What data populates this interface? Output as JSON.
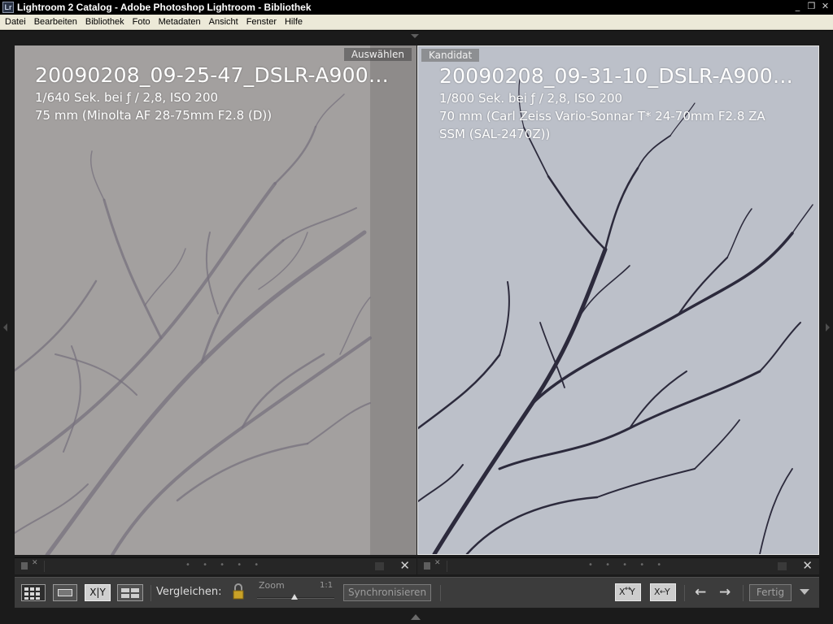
{
  "window": {
    "app_icon": "Lr",
    "title": "Lightroom 2 Catalog - Adobe Photoshop Lightroom - Bibliothek",
    "controls": [
      "minimize-icon",
      "restore-icon",
      "close-icon"
    ]
  },
  "menu": [
    "Datei",
    "Bearbeiten",
    "Bibliothek",
    "Foto",
    "Metadaten",
    "Ansicht",
    "Fenster",
    "Hilfe"
  ],
  "select_panel": {
    "badge": "Auswählen",
    "filename": "20090208_09-25-47_DSLR-A900…",
    "exposure": "1/640 Sek. bei ƒ / 2,8, ISO 200",
    "lens_line1": "75 mm (Minolta AF 28-75mm F2.8 (D))",
    "lens_line2": ""
  },
  "candidate_panel": {
    "badge": "Kandidat",
    "filename": "20090208_09-31-10_DSLR-A900…",
    "exposure": "1/800 Sek. bei ƒ / 2,8, ISO 200",
    "lens_line1": "70 mm (Carl Zeiss Vario-Sonnar T* 24-70mm F2.8 ZA",
    "lens_line2": "SSM (SAL-2470Z))"
  },
  "panel_footer": {
    "dots": "• • • • •",
    "close": "✕"
  },
  "toolbar": {
    "grid_icon": "grid-view-icon",
    "loupe_icon": "loupe-view-icon",
    "compare_label": "X|Y",
    "survey_icon": "survey-view-icon",
    "compare_text": "Vergleichen:",
    "lock_icon": "lock-icon",
    "zoom_label": "Zoom",
    "zoom_value": "1:1",
    "zoom_level": 0.48,
    "sync_label": "Synchronisieren",
    "swap_icon": "swap-icon",
    "make_select_icon": "make-select-icon",
    "prev_icon": "←",
    "next_icon": "→",
    "done_label": "Fertig"
  },
  "colors": {
    "left_photo_bg": "#a3a09f",
    "right_photo_bg": "#bcc0c9",
    "chrome": "#3c3c3c"
  }
}
